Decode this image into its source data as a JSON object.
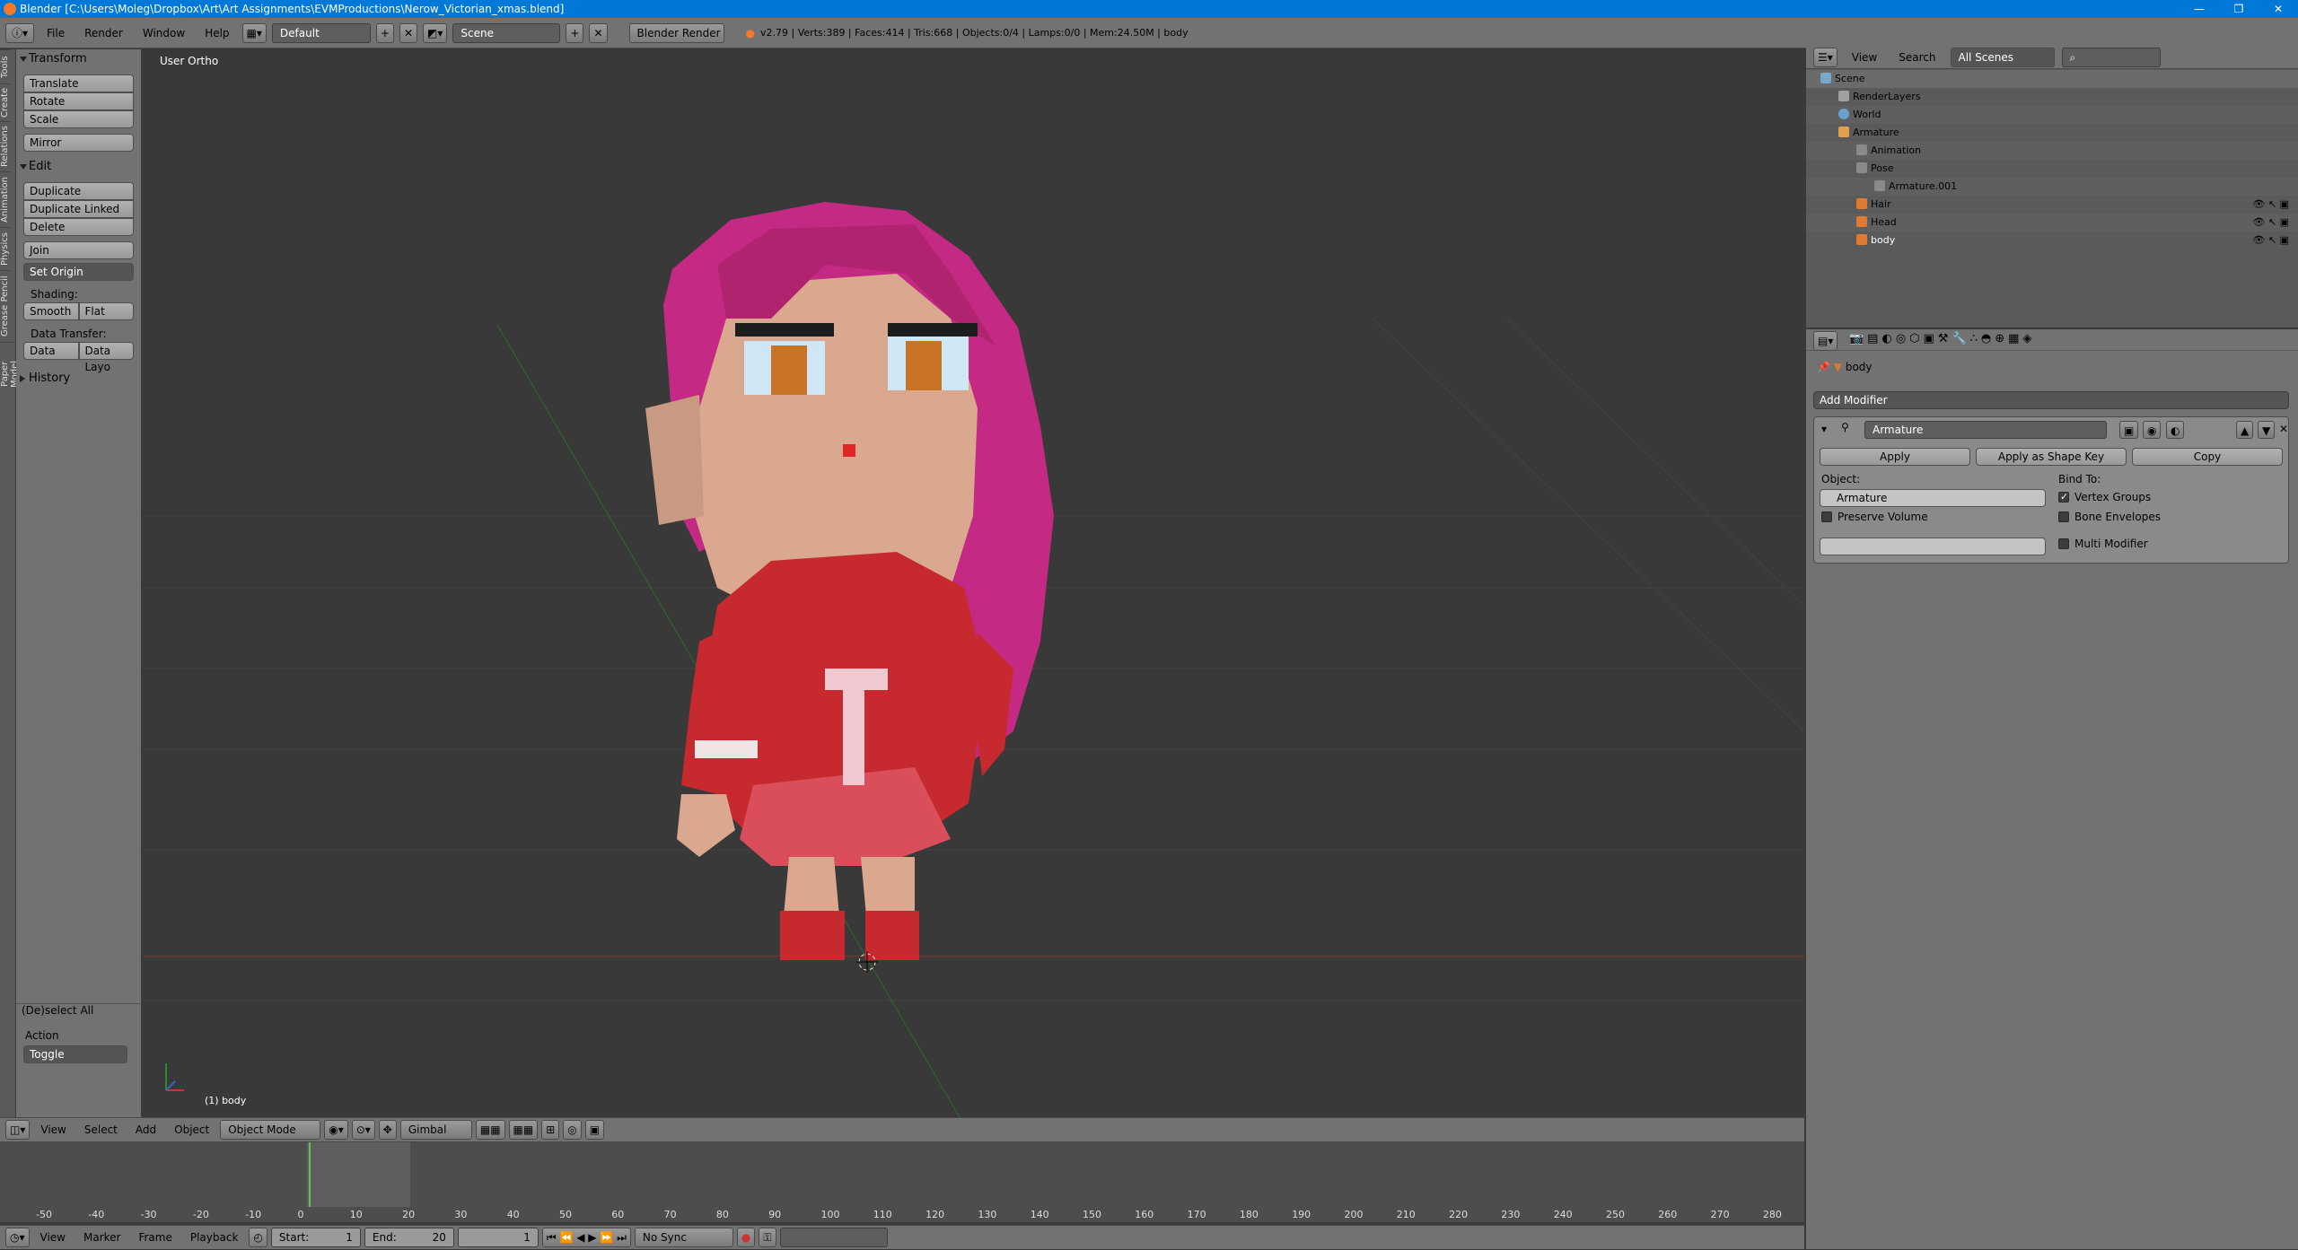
{
  "window": {
    "title": "Blender [C:\\Users\\Moleg\\Dropbox\\Art\\Art Assignments\\EVMProductions\\Nerow_Victorian_xmas.blend]",
    "controls": [
      "—",
      "❐",
      "✕"
    ]
  },
  "info": {
    "menus": [
      "File",
      "Render",
      "Window",
      "Help"
    ],
    "layout": "Default",
    "scene": "Scene",
    "engine": "Blender Render",
    "stats": "v2.79 | Verts:389 | Faces:414 | Tris:668 | Objects:0/4 | Lamps:0/0 | Mem:24.50M | body"
  },
  "toolstrip": [
    "Tools",
    "Create",
    "Relations",
    "Animation",
    "Physics",
    "Grease Pencil",
    "Paper Model"
  ],
  "toolshelf": {
    "transform_title": "Transform",
    "translate": "Translate",
    "rotate": "Rotate",
    "scale": "Scale",
    "mirror": "Mirror",
    "edit_title": "Edit",
    "duplicate": "Duplicate",
    "duplicate_linked": "Duplicate Linked",
    "delete": "Delete",
    "join": "Join",
    "set_origin": "Set Origin",
    "shading_label": "Shading:",
    "smooth": "Smooth",
    "flat": "Flat",
    "data_transfer_label": "Data Transfer:",
    "data": "Data",
    "data_layo": "Data Layo",
    "history_title": "History",
    "operator_title": "(De)select All",
    "action_label": "Action",
    "action_value": "Toggle"
  },
  "viewport": {
    "view_label": "User Ortho",
    "object_label": "(1) body"
  },
  "view3d_header": {
    "menus": [
      "View",
      "Select",
      "Add",
      "Object"
    ],
    "mode": "Object Mode",
    "orientation": "Gimbal"
  },
  "timeline": {
    "ticks": [
      "-50",
      "-40",
      "-30",
      "-20",
      "-10",
      "0",
      "10",
      "20",
      "30",
      "40",
      "50",
      "60",
      "70",
      "80",
      "90",
      "100",
      "110",
      "120",
      "130",
      "140",
      "150",
      "160",
      "170",
      "180",
      "190",
      "200",
      "210",
      "220",
      "230",
      "240",
      "250",
      "260",
      "270",
      "280"
    ],
    "menus": [
      "View",
      "Marker",
      "Frame",
      "Playback"
    ],
    "start_label": "Start:",
    "start": "1",
    "end_label": "End:",
    "end": "20",
    "current": "1",
    "sync": "No Sync",
    "current_frame": 0,
    "range_start": 1,
    "range_end": 20
  },
  "outliner": {
    "menus": [
      "View",
      "Search"
    ],
    "filter": "All Scenes",
    "rows": [
      {
        "label": "Scene",
        "indent": 0
      },
      {
        "label": "RenderLayers",
        "indent": 1
      },
      {
        "label": "World",
        "indent": 1
      },
      {
        "label": "Armature",
        "indent": 1
      },
      {
        "label": "Animation",
        "indent": 2
      },
      {
        "label": "Pose",
        "indent": 2
      },
      {
        "label": "Armature.001",
        "indent": 2
      },
      {
        "label": "Hair",
        "indent": 2
      },
      {
        "label": "Head",
        "indent": 2
      },
      {
        "label": "body",
        "indent": 2
      }
    ]
  },
  "properties": {
    "context": "body",
    "add_modifier": "Add Modifier",
    "modifier": {
      "name": "Armature",
      "apply": "Apply",
      "apply_shape": "Apply as Shape Key",
      "copy": "Copy",
      "object_label": "Object:",
      "object_value": "Armature",
      "bind_label": "Bind To:",
      "vertex_groups": "Vertex Groups",
      "preserve_volume": "Preserve Volume",
      "bone_envelopes": "Bone Envelopes",
      "multi_modifier": "Multi Modifier"
    }
  },
  "colors": {
    "accent": "#0078d7",
    "hair": "#c42a84",
    "sweater": "#c62a2e",
    "skin": "#d9a88f"
  }
}
